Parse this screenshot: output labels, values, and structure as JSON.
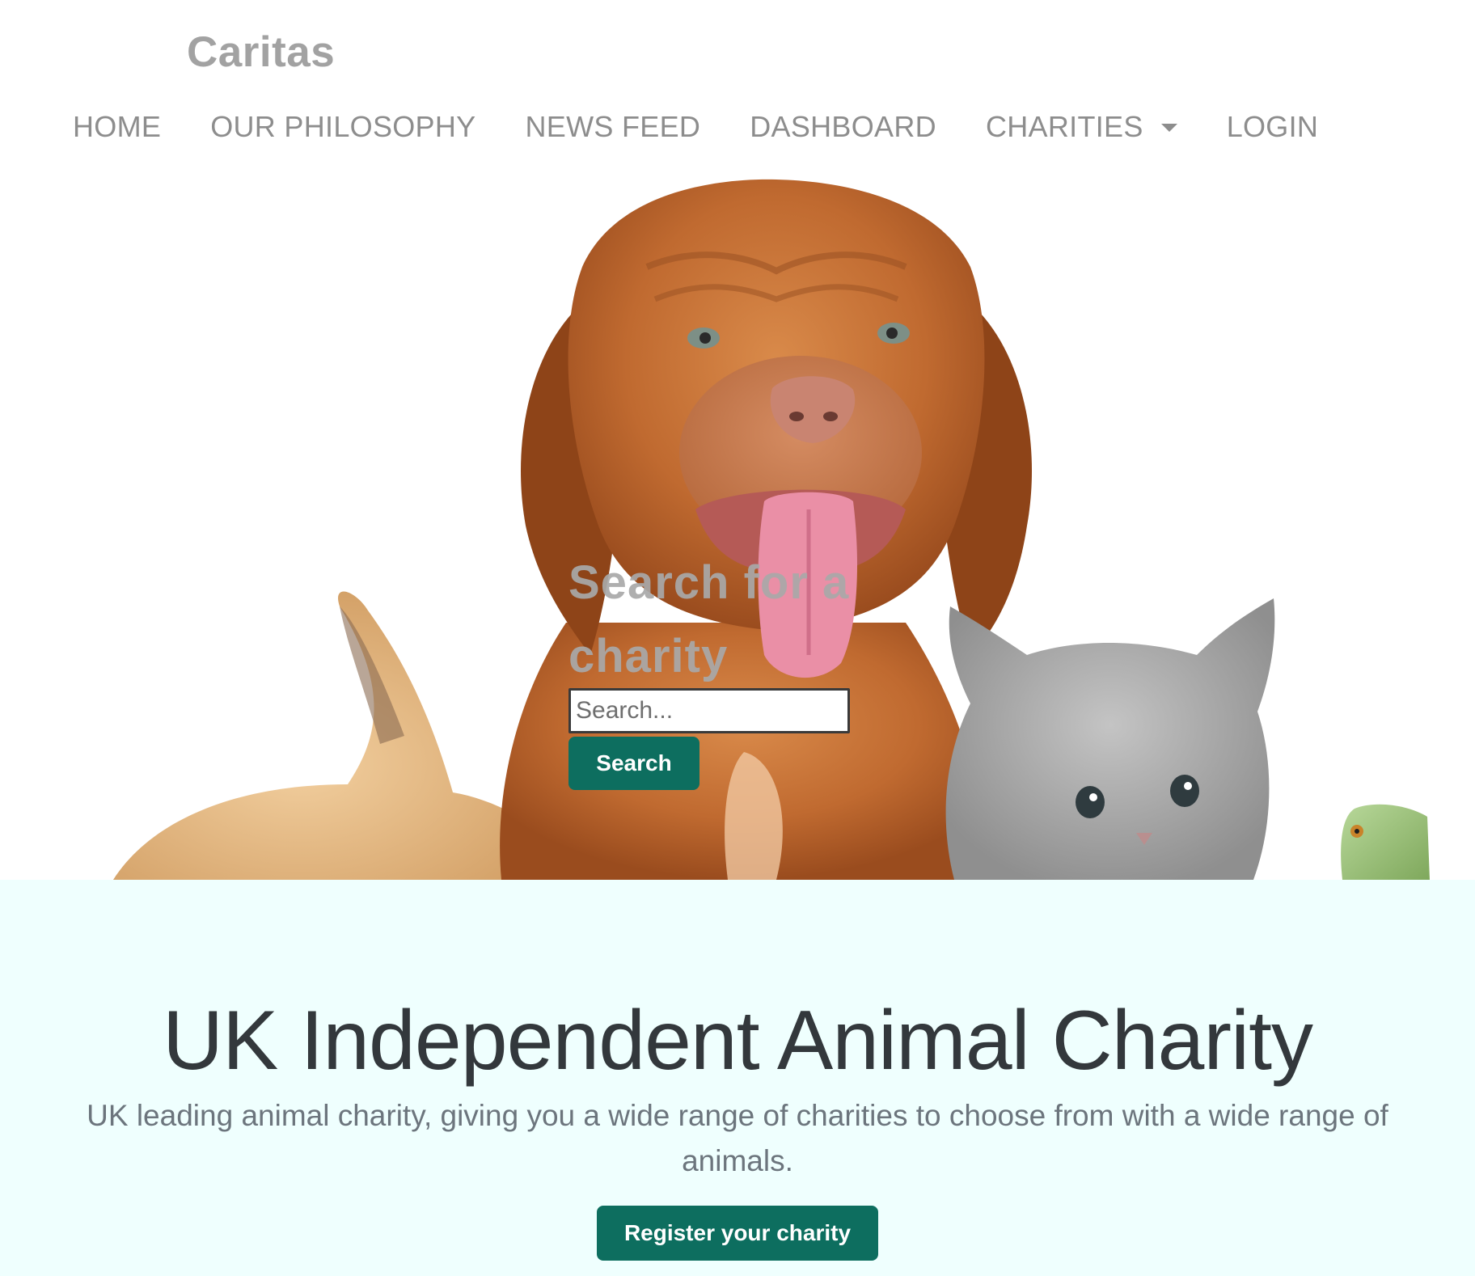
{
  "brand": {
    "name": "Caritas"
  },
  "nav": {
    "items": [
      {
        "label": "HOME"
      },
      {
        "label": "OUR PHILOSOPHY"
      },
      {
        "label": "NEWS FEED"
      },
      {
        "label": "DASHBOARD"
      },
      {
        "label": "CHARITIES",
        "has_dropdown": true
      },
      {
        "label": "LOGIN"
      }
    ]
  },
  "hero": {
    "search_title": "Search for a charity",
    "search_placeholder": "Search...",
    "search_value": "",
    "search_button": "Search"
  },
  "intro": {
    "title": "UK Independent Animal Charity",
    "text": "UK leading animal charity, giving you a wide range of charities to choose from with a wide range of animals.",
    "register_button": "Register your charity"
  },
  "colors": {
    "accent": "#0d6e5f",
    "intro_background": "#effffe",
    "nav_text": "#8d8d8d"
  }
}
